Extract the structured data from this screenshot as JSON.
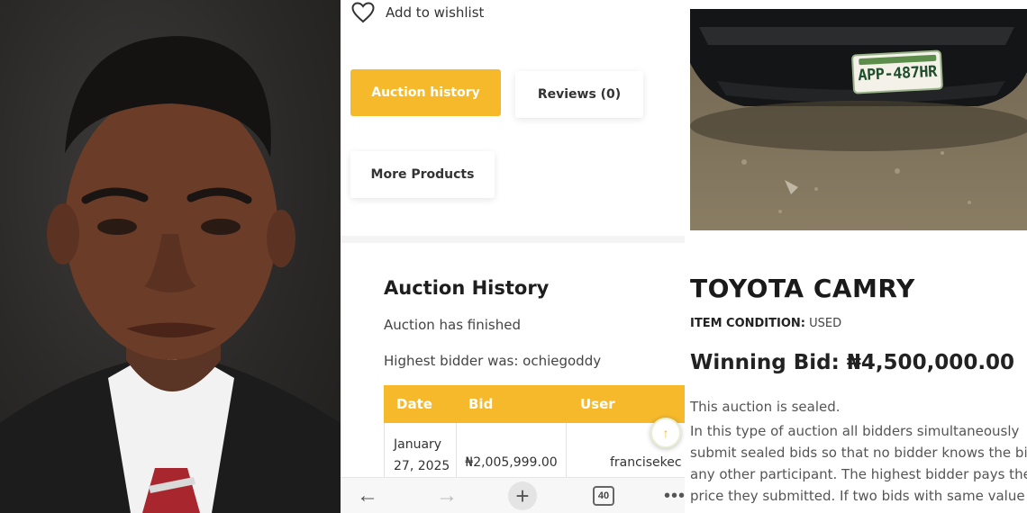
{
  "product_page": {
    "wishlist_label": "Add to wishlist",
    "tabs": [
      {
        "label": "Auction history",
        "active": true
      },
      {
        "label": "Reviews (0)",
        "active": false
      },
      {
        "label": "More Products",
        "active": false
      }
    ],
    "auction_history": {
      "title": "Auction History",
      "status": "Auction has finished",
      "highest_bidder": "Highest bidder was: ochiegoddy",
      "columns": [
        "Date",
        "Bid",
        "User"
      ],
      "rows": [
        {
          "date_line1": "January",
          "date_line2": "27, 2025",
          "bid": "₦2,005,999.00",
          "user": "francisekec"
        }
      ]
    },
    "scroll_top_icon": "arrow-up-icon"
  },
  "browser_nav": {
    "tab_count": "40",
    "icons": [
      "back-arrow-icon",
      "forward-arrow-icon",
      "plus-icon",
      "tabs-icon",
      "more-icon"
    ]
  },
  "product": {
    "plate_number": "APP-487HR",
    "title": "TOYOTA CAMRY",
    "condition_label": "ITEM CONDITION:",
    "condition_value": "USED",
    "winning_bid": "Winning Bid: ₦4,500,000.00",
    "sealed_notice": "This auction is sealed.",
    "description_lines": [
      "In this type of auction all bidders simultaneously",
      "submit sealed bids so that no bidder knows the bi",
      "any other participant. The highest bidder pays the",
      "price they submitted. If two bids with same value"
    ]
  },
  "colors": {
    "accent": "#f6b92b",
    "text_dark": "#1a1a1a",
    "text_muted": "#555555"
  }
}
